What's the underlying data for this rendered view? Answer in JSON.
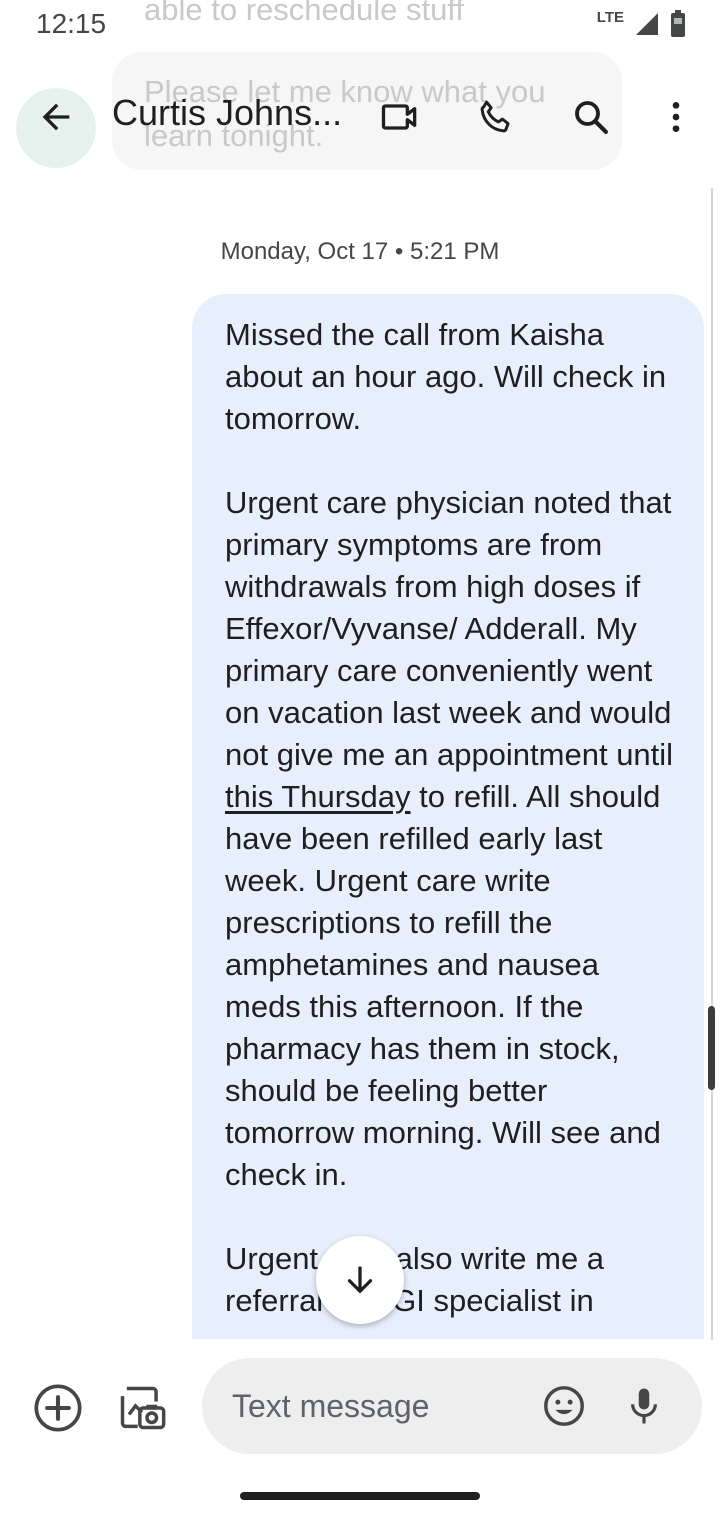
{
  "status_bar": {
    "time": "12:15",
    "network": "LTE",
    "icons": [
      "signal-icon",
      "battery-icon"
    ]
  },
  "background_messages": {
    "line_1": "able to reschedule stuff",
    "line_2": "Please let me know what you",
    "line_3": "learn tonight."
  },
  "app_bar": {
    "contact_name": "Curtis Johns...",
    "icons": [
      "back-arrow-icon",
      "video-call-icon",
      "phone-icon",
      "search-icon",
      "more-vert-icon"
    ]
  },
  "conversation": {
    "timestamp": "Monday, Oct 17 • 5:21 PM",
    "message": {
      "para_1": "Missed the call from Kaisha about an hour ago. Will check in tomorrow.",
      "para_2_before_link": "Urgent care physician noted that primary symptoms are from withdrawals from high doses if Effexor/Vyvanse/ Adderall. My primary care conveniently went on vacation last week and would not give me an appointment until ",
      "para_2_link": "this Thursday",
      "para_2_after_link": " to refill. All should have been refilled early last week. Urgent care write prescriptions to refill the amphetamines and nausea meds this afternoon. If the pharmacy has them in stock, should be feeling better tomorrow morning. Will see and check in.",
      "para_3": "Urgent care also write me a referral to a GI specialist in"
    }
  },
  "composer": {
    "placeholder": "Text message",
    "icons": [
      "add-circle-icon",
      "gallery-icon",
      "emoji-icon",
      "mic-icon",
      "scroll-down-arrow-icon"
    ]
  },
  "colors": {
    "bubble_background": "#e8effc",
    "composer_background": "#eeeeee",
    "text_primary": "#1f1f1f",
    "text_secondary": "#444746"
  }
}
